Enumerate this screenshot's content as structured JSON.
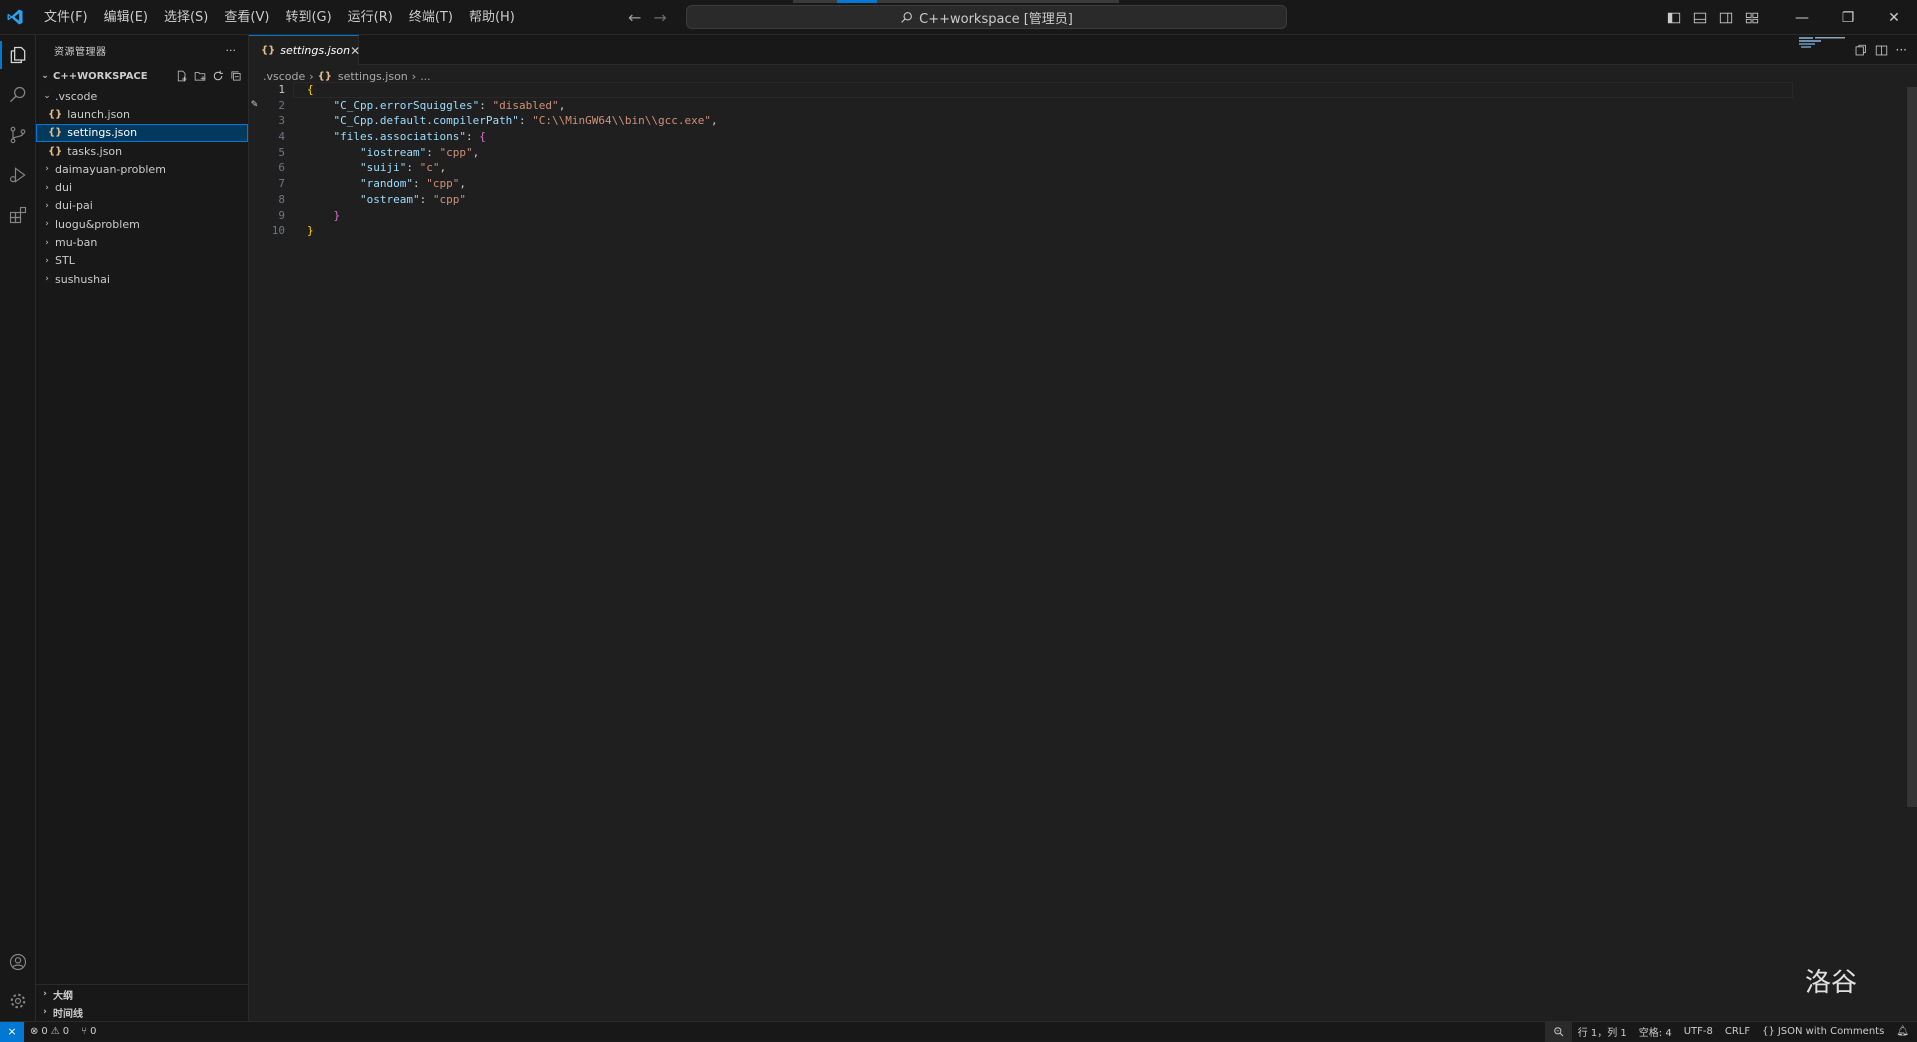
{
  "titlebar": {
    "menus": [
      "文件(F)",
      "编辑(E)",
      "选择(S)",
      "查看(V)",
      "转到(G)",
      "运行(R)",
      "终端(T)",
      "帮助(H)"
    ],
    "command_center": "C++workspace [管理员]"
  },
  "sidebar": {
    "title": "资源管理器",
    "more_label": "···",
    "workspace": "C++WORKSPACE",
    "tree": {
      "vscode_folder": ".vscode",
      "launch": "launch.json",
      "settings": "settings.json",
      "tasks": "tasks.json",
      "folders": [
        "daimayuan-problem",
        "dui",
        "dui-pai",
        "luogu&problem",
        "mu-ban",
        "STL",
        "sushushai"
      ]
    },
    "footer": {
      "outline": "大纲",
      "timeline": "时间线"
    },
    "json_badge": "{}"
  },
  "editor": {
    "tab_label": "settings.json",
    "tab_close": "✕",
    "breadcrumb": {
      "folder": ".vscode",
      "file": "settings.json",
      "ellipsis": "..."
    },
    "lines": [
      {
        "num": "1",
        "tokens": [
          {
            "c": "b1",
            "t": "{"
          }
        ]
      },
      {
        "num": "2",
        "tokens": [
          {
            "c": "p",
            "t": "    "
          },
          {
            "c": "k",
            "t": "\"C_Cpp.errorSquiggles\""
          },
          {
            "c": "p",
            "t": ": "
          },
          {
            "c": "s",
            "t": "\"disabled\""
          },
          {
            "c": "p",
            "t": ","
          }
        ]
      },
      {
        "num": "3",
        "tokens": [
          {
            "c": "p",
            "t": "    "
          },
          {
            "c": "k",
            "t": "\"C_Cpp.default.compilerPath\""
          },
          {
            "c": "p",
            "t": ": "
          },
          {
            "c": "s",
            "t": "\"C:\\\\MinGW64\\\\bin\\\\gcc.exe\""
          },
          {
            "c": "p",
            "t": ","
          }
        ]
      },
      {
        "num": "4",
        "tokens": [
          {
            "c": "p",
            "t": "    "
          },
          {
            "c": "k",
            "t": "\"files.associations\""
          },
          {
            "c": "p",
            "t": ": "
          },
          {
            "c": "b2",
            "t": "{"
          }
        ]
      },
      {
        "num": "5",
        "tokens": [
          {
            "c": "p",
            "t": "        "
          },
          {
            "c": "k",
            "t": "\"iostream\""
          },
          {
            "c": "p",
            "t": ": "
          },
          {
            "c": "s",
            "t": "\"cpp\""
          },
          {
            "c": "p",
            "t": ","
          }
        ]
      },
      {
        "num": "6",
        "tokens": [
          {
            "c": "p",
            "t": "        "
          },
          {
            "c": "k",
            "t": "\"suiji\""
          },
          {
            "c": "p",
            "t": ": "
          },
          {
            "c": "s",
            "t": "\"c\""
          },
          {
            "c": "p",
            "t": ","
          }
        ]
      },
      {
        "num": "7",
        "tokens": [
          {
            "c": "p",
            "t": "        "
          },
          {
            "c": "k",
            "t": "\"random\""
          },
          {
            "c": "p",
            "t": ": "
          },
          {
            "c": "s",
            "t": "\"cpp\""
          },
          {
            "c": "p",
            "t": ","
          }
        ]
      },
      {
        "num": "8",
        "tokens": [
          {
            "c": "p",
            "t": "        "
          },
          {
            "c": "k",
            "t": "\"ostream\""
          },
          {
            "c": "p",
            "t": ": "
          },
          {
            "c": "s",
            "t": "\"cpp\""
          }
        ]
      },
      {
        "num": "9",
        "tokens": [
          {
            "c": "p",
            "t": "    "
          },
          {
            "c": "b2",
            "t": "}"
          }
        ]
      },
      {
        "num": "10",
        "tokens": [
          {
            "c": "b1",
            "t": "}"
          }
        ]
      }
    ],
    "watermark": "洛谷"
  },
  "statusbar": {
    "errors": "0",
    "warnings": "0",
    "ports": "0",
    "position": "行 1，列 1",
    "spaces": "空格: 4",
    "encoding": "UTF-8",
    "eol": "CRLF",
    "language": "JSON with Comments"
  },
  "colors": {
    "accent": "#0078d4",
    "json_key": "#9cdcfe",
    "json_string": "#ce9178",
    "bracket_1": "#ffd700",
    "bracket_2": "#da70d6"
  }
}
